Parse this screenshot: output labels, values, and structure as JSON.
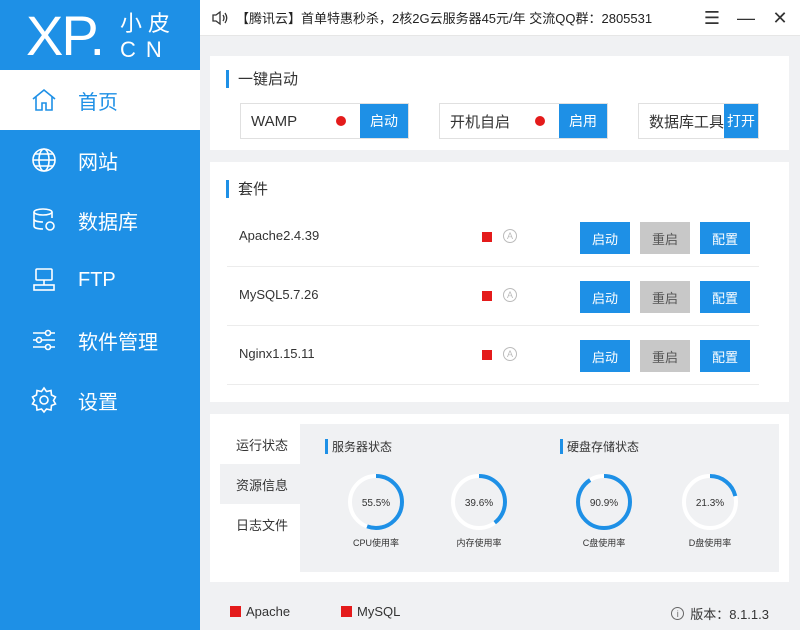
{
  "logo": {
    "main": "XP.",
    "small": "小皮",
    "cn": "CN"
  },
  "sidebar": {
    "items": [
      {
        "label": "首页",
        "icon": "home-icon"
      },
      {
        "label": "网站",
        "icon": "globe-icon"
      },
      {
        "label": "数据库",
        "icon": "database-icon"
      },
      {
        "label": "FTP",
        "icon": "ftp-icon"
      },
      {
        "label": "软件管理",
        "icon": "sliders-icon"
      },
      {
        "label": "设置",
        "icon": "gear-icon"
      }
    ],
    "active": "首页"
  },
  "topbar": {
    "notice": "【腾讯云】首单特惠秒杀，2核2G云服务器45元/年 交流QQ群：2805531",
    "menu_icon": "☰",
    "min_icon": "—",
    "close_icon": "✕"
  },
  "quick_start": {
    "title": "一键启动",
    "items": [
      {
        "label": "WAMP",
        "status_color": "#e41b1b",
        "button": "启动"
      },
      {
        "label": "开机自启",
        "status_color": "#e41b1b",
        "button": "启用"
      },
      {
        "label": "数据库工具",
        "button": "打开"
      }
    ]
  },
  "suites": {
    "title": "套件",
    "auto_glyph": "A",
    "rows": [
      {
        "name": "Apache2.4.39",
        "start": "启动",
        "restart": "重启",
        "config": "配置"
      },
      {
        "name": "MySQL5.7.26",
        "start": "启动",
        "restart": "重启",
        "config": "配置"
      },
      {
        "name": "Nginx1.15.11",
        "start": "启动",
        "restart": "重启",
        "config": "配置"
      }
    ]
  },
  "status": {
    "tabs": [
      "运行状态",
      "资源信息",
      "日志文件"
    ],
    "active_tab": "资源信息",
    "server_title": "服务器状态",
    "disk_title": "硬盘存储状态",
    "gauges": [
      {
        "label": "CPU使用率",
        "value": 55.5,
        "text": "55.5%"
      },
      {
        "label": "内存使用率",
        "value": 39.6,
        "text": "39.6%"
      },
      {
        "label": "C盘使用率",
        "value": 90.9,
        "text": "90.9%"
      },
      {
        "label": "D盘使用率",
        "value": 21.3,
        "text": "21.3%"
      }
    ],
    "gauge_color": "#1e90e6",
    "track_color": "#ffffff"
  },
  "bottombar": {
    "legend": [
      {
        "label": "Apache"
      },
      {
        "label": "MySQL"
      }
    ],
    "info_glyph": "i",
    "version": "版本：8.1.1.3"
  }
}
